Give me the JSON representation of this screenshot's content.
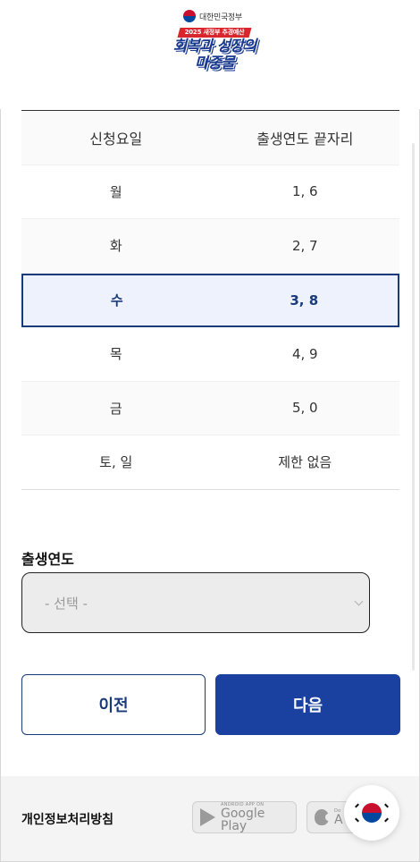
{
  "header": {
    "gov_name": "대한민국정부",
    "banner_sub": "2025 새정부 추경예산",
    "banner_title_line1": "회복과 성장의",
    "banner_title_line2": "마중물"
  },
  "schedule": {
    "headers": [
      "신청요일",
      "출생연도 끝자리"
    ],
    "rows": [
      {
        "day": "월",
        "digits": "1, 6"
      },
      {
        "day": "화",
        "digits": "2, 7"
      },
      {
        "day": "수",
        "digits": "3, 8",
        "highlighted": true
      },
      {
        "day": "목",
        "digits": "4, 9"
      },
      {
        "day": "금",
        "digits": "5, 0"
      },
      {
        "day": "토, 일",
        "digits": "제한 없음"
      }
    ]
  },
  "birth_year": {
    "label": "출생연도",
    "selected": "- 선택 -"
  },
  "buttons": {
    "prev": "이전",
    "next": "다음"
  },
  "footer": {
    "privacy": "개인정보처리방침",
    "google_small": "ANDROID APP ON",
    "google_big": "Google Play",
    "apple_small": "Do",
    "apple_big": "A"
  },
  "colors": {
    "primary": "#1b41a0",
    "highlight_border": "#1a3a7a",
    "highlight_bg": "#edf2fc"
  }
}
